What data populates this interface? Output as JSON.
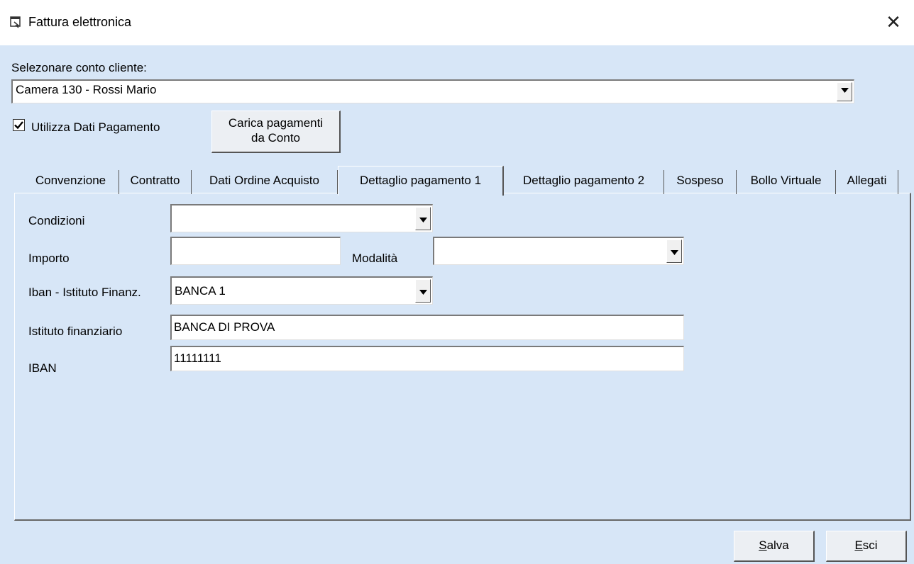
{
  "window": {
    "title": "Fattura elettronica",
    "icon": "window-app-icon",
    "close_icon": "close-icon",
    "close_glyph": "✕"
  },
  "account": {
    "label": "Selezonare conto cliente:",
    "selected": "Camera 130 - Rossi Mario"
  },
  "payment": {
    "use_label": "Utilizza Dati Pagamento",
    "use_checked": true,
    "load_button": [
      "Carica pagamenti",
      "da Conto"
    ]
  },
  "tabs": [
    {
      "label": "Convenzione",
      "active": false
    },
    {
      "label": "Contratto",
      "active": false
    },
    {
      "label": "Dati Ordine Acquisto",
      "active": false
    },
    {
      "label": "Dettaglio pagamento 1",
      "active": true
    },
    {
      "label": "Dettaglio pagamento 2",
      "active": false
    },
    {
      "label": "Sospeso",
      "active": false
    },
    {
      "label": "Bollo Virtuale",
      "active": false
    },
    {
      "label": "Allegati",
      "active": false
    }
  ],
  "form": {
    "condizioni_label": "Condizioni",
    "condizioni_value": "",
    "importo_label": "Importo",
    "importo_value": "",
    "modalita_label": "Modalità",
    "modalita_value": "",
    "iban_istituto_label": "Iban - Istituto Finanz.",
    "iban_istituto_value": "BANCA 1",
    "istituto_label": "Istituto finanziario",
    "istituto_value": "BANCA DI PROVA",
    "iban_label": "IBAN",
    "iban_value": "11111111"
  },
  "buttons": {
    "save_accel": "S",
    "save_rest": "alva",
    "exit_accel": "E",
    "exit_rest": "sci"
  },
  "colors": {
    "background": "#d7e6f7",
    "titlebar": "#ffffff"
  }
}
